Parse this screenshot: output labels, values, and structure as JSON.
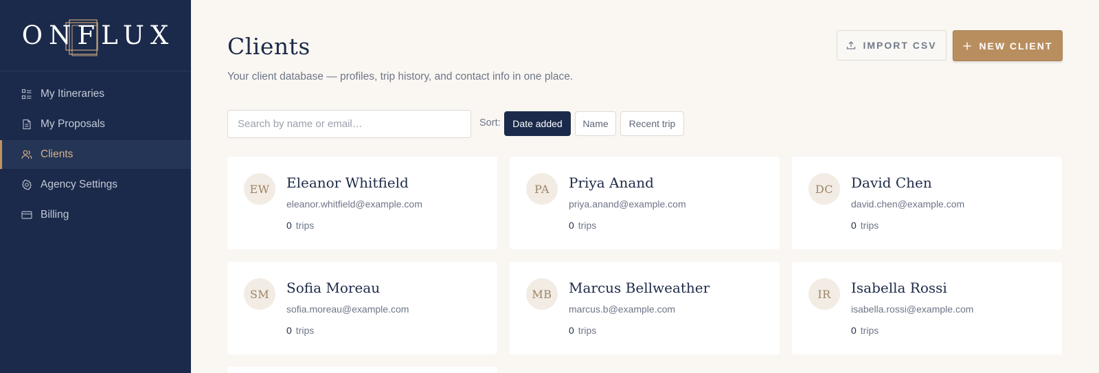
{
  "brand": {
    "logo_text": "ONFLUX"
  },
  "sidebar": {
    "items": [
      {
        "label": "My Itineraries",
        "icon": "itineraries-icon",
        "active": false
      },
      {
        "label": "My Proposals",
        "icon": "document-icon",
        "active": false
      },
      {
        "label": "Clients",
        "icon": "users-icon",
        "active": true
      },
      {
        "label": "Agency Settings",
        "icon": "gear-icon",
        "active": false
      },
      {
        "label": "Billing",
        "icon": "credit-card-icon",
        "active": false
      }
    ]
  },
  "header": {
    "title": "Clients",
    "subtitle": "Your client database — profiles, trip history, and contact info in one place.",
    "import_label": "IMPORT CSV",
    "new_label": "NEW CLIENT"
  },
  "search": {
    "placeholder": "Search by name or email…",
    "value": ""
  },
  "sort": {
    "label": "Sort:",
    "options": [
      {
        "label": "Date added",
        "active": true
      },
      {
        "label": "Name",
        "active": false
      },
      {
        "label": "Recent trip",
        "active": false
      }
    ]
  },
  "clients": [
    {
      "initials": "EW",
      "name": "Eleanor Whitfield",
      "email": "eleanor.whitfield@example.com",
      "trips": "0",
      "trips_label": "trips"
    },
    {
      "initials": "PA",
      "name": "Priya Anand",
      "email": "priya.anand@example.com",
      "trips": "0",
      "trips_label": "trips"
    },
    {
      "initials": "DC",
      "name": "David Chen",
      "email": "david.chen@example.com",
      "trips": "0",
      "trips_label": "trips"
    },
    {
      "initials": "SM",
      "name": "Sofia Moreau",
      "email": "sofia.moreau@example.com",
      "trips": "0",
      "trips_label": "trips"
    },
    {
      "initials": "MB",
      "name": "Marcus Bellweather",
      "email": "marcus.b@example.com",
      "trips": "0",
      "trips_label": "trips"
    },
    {
      "initials": "IR",
      "name": "Isabella Rossi",
      "email": "isabella.rossi@example.com",
      "trips": "0",
      "trips_label": "trips"
    }
  ],
  "colors": {
    "sidebar_bg": "#1b2a4b",
    "accent": "#b98e5f",
    "active_nav_text": "#d6b18a",
    "page_bg": "#faf7f3"
  }
}
